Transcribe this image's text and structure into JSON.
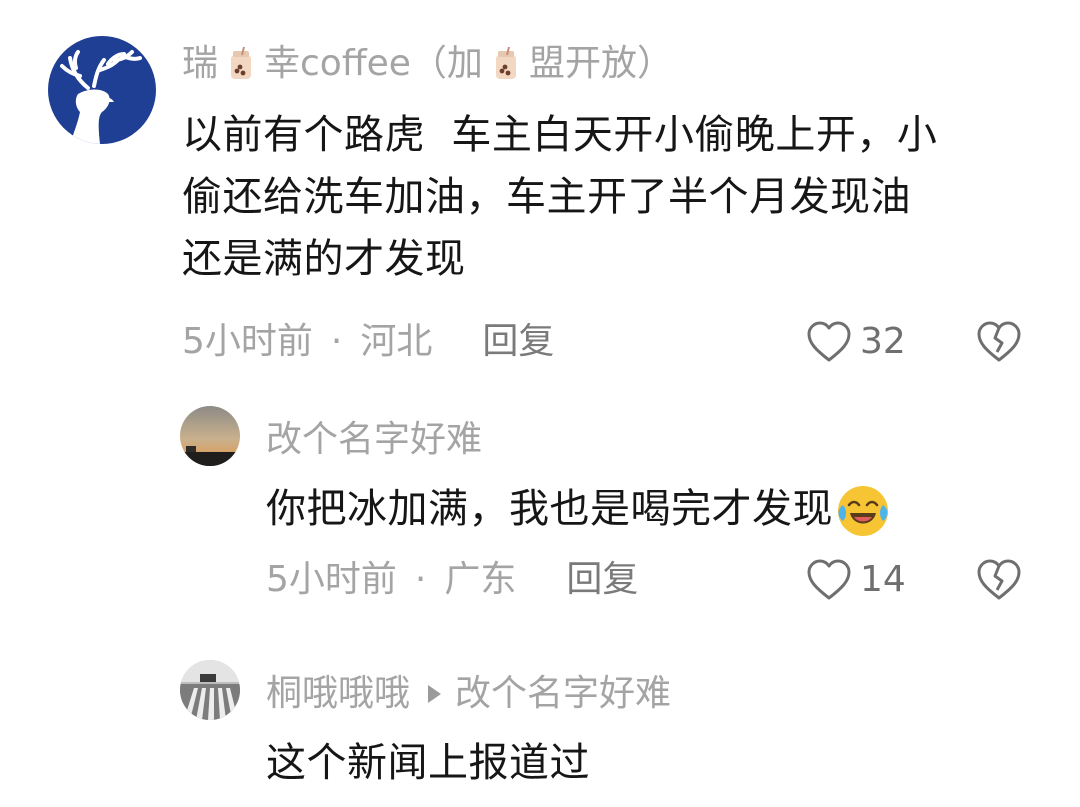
{
  "comments": [
    {
      "username_prefix": "瑞",
      "username_mid": "幸coffee（加",
      "username_suffix": "盟开放）",
      "text_lines": [
        "以前有个路虎  车主白天开小偷晚上开，小",
        "偷还给洗车加油，车主开了半个月发现油",
        "还是满的才发现"
      ],
      "time": "5小时前",
      "dot": "·",
      "location": "河北",
      "reply_label": "回复",
      "like_count": "32",
      "avatar_icon": "deer-logo-icon"
    },
    {
      "username": "改个名字好难",
      "text": "你把冰加满，我也是喝完才发现",
      "emoji": "laughing-crying-emoji",
      "time": "5小时前",
      "dot": "·",
      "location": "广东",
      "reply_label": "回复",
      "like_count": "14",
      "avatar_icon": "sunset-photo-avatar"
    },
    {
      "username": "桐哦哦哦",
      "reply_to": "改个名字好难",
      "text": "这个新闻上报道过",
      "avatar_icon": "crosswalk-photo-avatar"
    }
  ],
  "colors": {
    "brand_blue": "#1f3f94",
    "meta_gray": "#a4a4a4",
    "text": "#161616"
  }
}
